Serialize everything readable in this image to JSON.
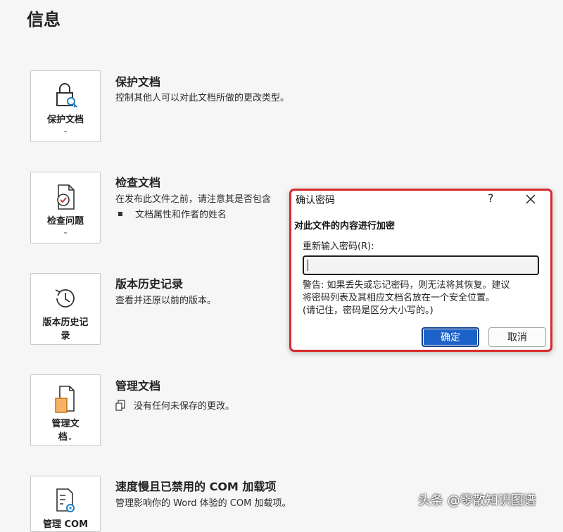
{
  "page": {
    "title": "信息"
  },
  "sections": {
    "protect": {
      "tile_label": "保护文档",
      "title": "保护文档",
      "desc": "控制其他人可以对此文档所做的更改类型。"
    },
    "inspect": {
      "tile_label": "检查问题",
      "title": "检查文档",
      "desc": "在发布此文件之前，请注意其是否包含",
      "bullet": "文档属性和作者的姓名"
    },
    "history": {
      "tile_label_line1": "版本历史记",
      "tile_label_line2": "录",
      "title": "版本历史记录",
      "desc": "查看并还原以前的版本。"
    },
    "manage": {
      "tile_label_line1": "管理文",
      "tile_label_line2": "档",
      "title": "管理文档",
      "desc": "没有任何未保存的更改。"
    },
    "com": {
      "tile_label": "管理 COM",
      "title": "速度慢且已禁用的 COM 加载项",
      "desc": "管理影响你的 Word 体验的 COM 加载项。"
    }
  },
  "dialog": {
    "title": "确认密码",
    "help": "?",
    "heading": "对此文件的内容进行加密",
    "field_label": "重新输入密码(R):",
    "field_value": "",
    "warning_lines": [
      "警告: 如果丢失或忘记密码，则无法将其恢复。建议",
      "将密码列表及其相应文档名放在一个安全位置。",
      "(请记住，密码是区分大小写的。)"
    ],
    "ok_label": "确定",
    "cancel_label": "取消"
  },
  "watermark": "头条 @零散知识图谱",
  "icons": {
    "protect": "lock-key-icon",
    "inspect": "document-check-icon",
    "history": "clock-history-icon",
    "manage": "document-manage-icon",
    "com": "document-gear-icon",
    "chevron": "chevron-down-icon",
    "close": "close-icon",
    "unsaved": "document-copy-icon"
  },
  "colors": {
    "dialog_border": "#d82a2a",
    "primary_button": "#1d62c9"
  }
}
